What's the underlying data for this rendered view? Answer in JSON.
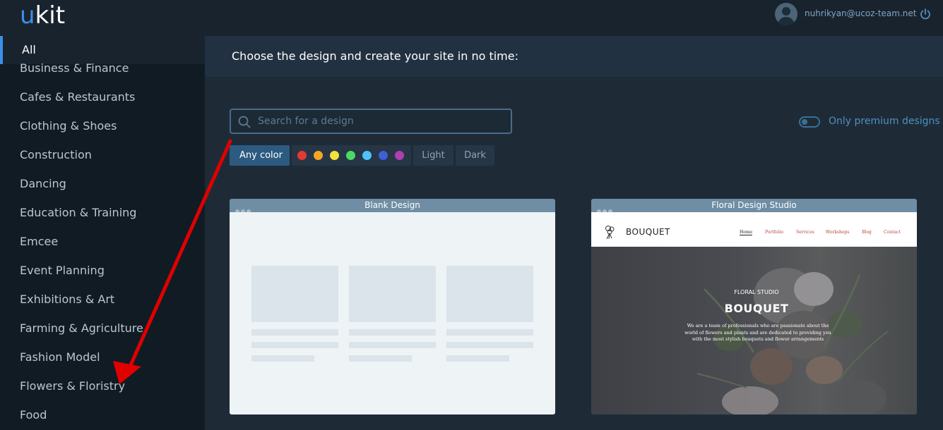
{
  "app": {
    "logo_u": "u",
    "logo_kit": "kit",
    "user_email": "nuhrikyan@ucoz-team.net"
  },
  "sidebar": {
    "selected": "All",
    "items": [
      "Business & Finance",
      "Cafes & Restaurants",
      "Clothing & Shoes",
      "Construction",
      "Dancing",
      "Education & Training",
      "Emcee",
      "Event Planning",
      "Exhibitions & Art",
      "Farming & Agriculture",
      "Fashion Model",
      "Flowers & Floristry",
      "Food"
    ]
  },
  "main": {
    "heading": "Choose the design and create your site in no time:",
    "search_placeholder": "Search for a design",
    "premium_toggle_label": "Only premium designs",
    "premium_toggle_on": false,
    "filters": {
      "any_color": "Any color",
      "light": "Light",
      "dark": "Dark",
      "colors": [
        "#e53935",
        "#f5a623",
        "#f4e23a",
        "#4cd964",
        "#4fc3f7",
        "#3e5fd6",
        "#b03fb0"
      ]
    },
    "cards": [
      {
        "title": "Blank Design"
      },
      {
        "title": "Floral Design Studio",
        "preview": {
          "brand": "BOUQUET",
          "nav": [
            "Home",
            "Portfolio",
            "Services",
            "Workshops",
            "Blog",
            "Contact"
          ],
          "kicker": "FLORAL STUDIO",
          "hero_title": "BOUQUET",
          "description": "We are a team of professionals who are passionate about the world of flowers and plants and are dedicated to providing you with the most stylish bouquets and flower arrangements"
        }
      }
    ]
  },
  "colors": {
    "accent": "#3d8ee8",
    "sidebar_bg": "#111b24",
    "main_bg": "#1e2b37",
    "annotation_arrow": "#e00000"
  }
}
